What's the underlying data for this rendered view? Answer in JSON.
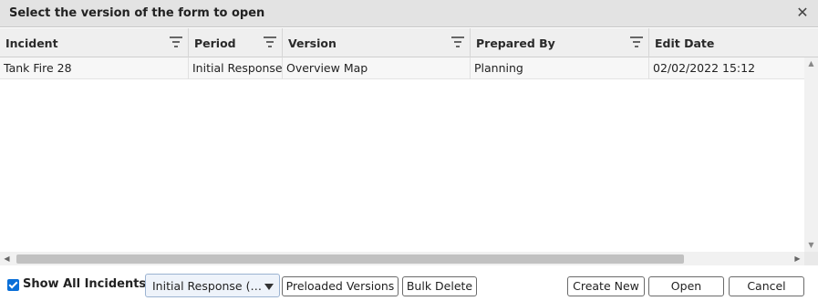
{
  "dialog": {
    "title": "Select the version of the form to open",
    "close_glyph": "✕"
  },
  "grid": {
    "columns": [
      {
        "label": "Incident",
        "filter_icon": "filter-icon"
      },
      {
        "label": "Period",
        "filter_icon": "filter-icon"
      },
      {
        "label": "Version",
        "filter_icon": "filter-icon"
      },
      {
        "label": "Prepared By",
        "filter_icon": "filter-icon"
      },
      {
        "label": "Edit Date",
        "filter_icon": null
      }
    ],
    "rows": [
      {
        "incident": "Tank Fire 28",
        "period": "Initial Response",
        "version": "Overview Map",
        "prepared_by": "Planning",
        "edit_date": "02/02/2022 15:12"
      }
    ],
    "scroll": {
      "up": "▲",
      "down": "▼",
      "left": "◀",
      "right": "▶"
    }
  },
  "footer": {
    "show_all_label": "Show All Incidents",
    "show_all_checked": true,
    "period_select_value": "Initial Response (…",
    "preloaded_label": "Preloaded Versions",
    "bulk_delete_label": "Bulk Delete",
    "create_new_label": "Create New",
    "open_label": "Open",
    "cancel_label": "Cancel"
  },
  "colors": {
    "checkbox_accent": "#0a6fd8",
    "title_bar": "#e3e3e3",
    "header_bg": "#efefef"
  }
}
